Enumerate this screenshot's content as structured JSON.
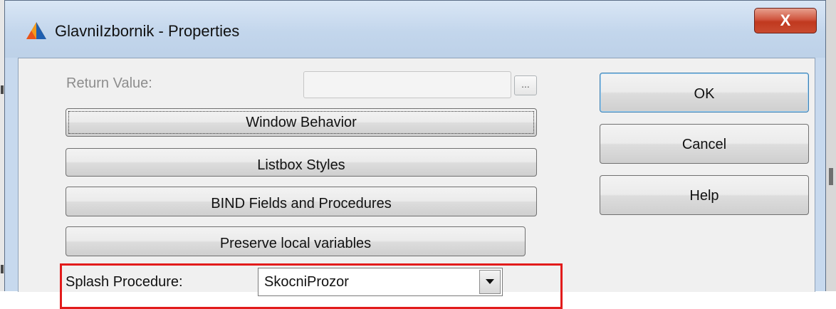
{
  "window": {
    "title": "GlavniIzbornik - Properties",
    "close_label": "X",
    "app_icon": "clarion-triangle-icon"
  },
  "form": {
    "return_value_label": "Return Value:",
    "return_value": "",
    "ellipsis_label": "...",
    "splash_procedure_label": "Splash Procedure:",
    "splash_procedure_value": "SkocniProzor"
  },
  "buttons": {
    "window_behavior": "Window Behavior",
    "listbox_styles": "Listbox Styles",
    "bind_fields": "BIND Fields and Procedures",
    "preserve_local": "Preserve local variables"
  },
  "dialog_buttons": {
    "ok": "OK",
    "cancel": "Cancel",
    "help": "Help"
  },
  "colors": {
    "highlight": "#e21b1b",
    "close_button": "#c94a30",
    "title_bar": "#c7d9ee"
  }
}
